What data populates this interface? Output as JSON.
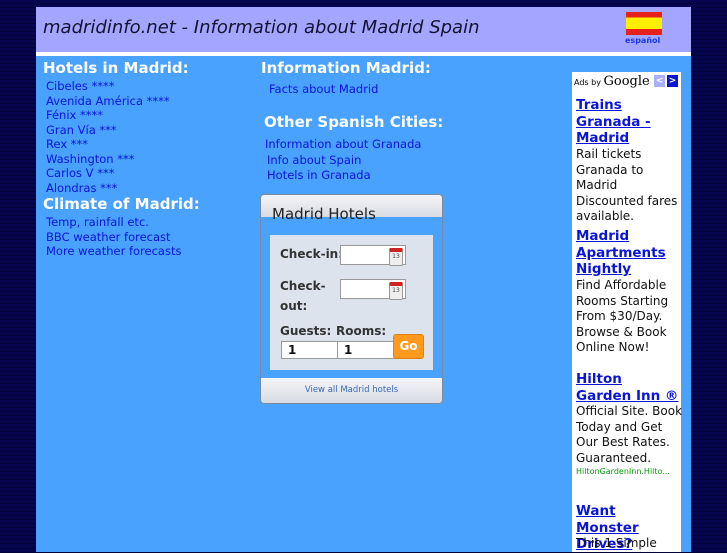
{
  "header": {
    "title": "madridinfo.net - Information about Madrid Spain",
    "language_link": "español",
    "flag_icon": "spain-flag-icon"
  },
  "hotels": {
    "heading": "Hotels in Madrid:",
    "items": [
      "Cibeles ****",
      "Avenida América ****",
      "Fénix ****",
      "Gran Vía ***",
      "Rex ***",
      "Washington ***",
      "Carlos V ***",
      "Alondras ***"
    ]
  },
  "climate": {
    "heading": "Climate of Madrid:",
    "items": [
      "Temp, rainfall etc.",
      "BBC weather forecast",
      "More weather forecasts"
    ]
  },
  "information": {
    "heading": "Information Madrid:",
    "items": [
      "Facts about Madrid"
    ]
  },
  "cities": {
    "heading": "Other Spanish Cities:",
    "items": [
      "Information about Granada",
      "Info about Spain",
      "Hotels in Granada"
    ]
  },
  "widget": {
    "title": "Madrid Hotels",
    "checkin_label": "Check-in:",
    "checkout_label_1": "Check-",
    "checkout_label_2": "out:",
    "guests_label": "Guests:",
    "rooms_label": "Rooms:",
    "checkin_value": "",
    "checkout_value": "",
    "guests_value": "1",
    "rooms_value": "1",
    "go_label": "Go",
    "calendar_day": "13",
    "view_all": "View all Madrid hotels"
  },
  "ads": {
    "ads_by": "Ads by",
    "brand": "Google",
    "prev": "<",
    "next": ">",
    "items": [
      {
        "title": "Trains Granada - Madrid",
        "text": "Rail tickets Granada to Madrid Discounted fares available.",
        "url": ""
      },
      {
        "title": "Madrid Apartments Nightly",
        "text": "Find Affordable Rooms Starting From $30/Day. Browse & Book Online Now!",
        "url": ""
      },
      {
        "title": "Hilton Garden Inn ®",
        "text": "Official Site. Book Today and Get Our Best Rates. Guaranteed.",
        "url": "HiltonGardenInn.Hilto..."
      },
      {
        "title": "Want Monster Drives?",
        "text": "This 1 Simple",
        "url": ""
      }
    ]
  },
  "colors": {
    "background": "#03034a",
    "page": "#4aa2ff",
    "header": "#a3a5ff",
    "link": "#0a14d8",
    "go_button": "#ff9a1e",
    "ad_url": "#0a9a0a"
  }
}
